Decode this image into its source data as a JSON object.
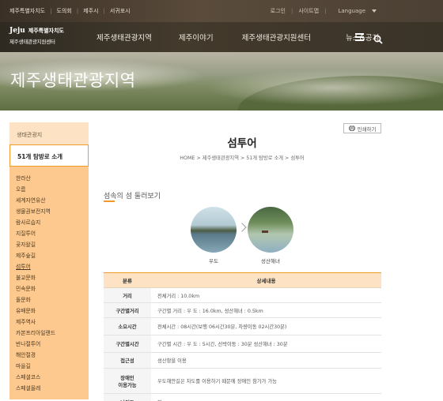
{
  "topbar": {
    "links": [
      "제주특별자치도",
      "도의회",
      "제주시",
      "서귀포시"
    ],
    "login": "로그인",
    "sitemap": "사이트맵",
    "language": "Language"
  },
  "logo": {
    "mark": "Jeju",
    "line1": "제주특별자치도",
    "line2": "제주생태관광지원센터"
  },
  "nav": {
    "items": [
      "제주생태관광지역",
      "제주이야기",
      "제주생태관광지원센터",
      "뉴스&공지"
    ]
  },
  "hero": {
    "title": "제주생태관광지역"
  },
  "sidebar": {
    "header": "생태관광지",
    "selected": "51개 탐방로 소개",
    "items": [
      "한라산",
      "오름",
      "세계자연유산",
      "생물권보전지역",
      "람사르습지",
      "지질투어",
      "곶자왈길",
      "제주숲길",
      "섬투어",
      "불교문화",
      "민속문화",
      "돌문화",
      "유배문화",
      "제주역사",
      "카본프리아일랜드",
      "반나절투어",
      "해안절경",
      "마을길",
      "스페셜코스",
      "스페셜올레"
    ],
    "active_index": 8
  },
  "content": {
    "print_label": "인쇄하기",
    "title": "섬투어",
    "breadcrumb": "HOME > 제주생태관광지역 > 51개 탐방로 소개 > 섬투어",
    "section_title": "섬속의 섬 둘러보기",
    "islands": [
      "우도",
      "성산해녀"
    ],
    "table_headers": [
      "분류",
      "상세내용"
    ],
    "rows": [
      {
        "key": "거리",
        "value": "전체거리 : 10.0km"
      },
      {
        "key": "구간별거리",
        "value": "구간별 거리 : 우 도 : 16.0km, 성산해녀 : 0.5km"
      },
      {
        "key": "소요시간",
        "value": "전체시간 : 08시간(보행 06시간30분, 차량이동 02시간30분)"
      },
      {
        "key": "구간별시간",
        "value": "구간별 시간 : 우 도 : 5시간, 선박이동 : 30분 성산해녀 : 30분"
      },
      {
        "key": "접근성",
        "value": "성산항을 이용"
      },
      {
        "key": "장애인\n이용가능",
        "value": "우도해안길은 차도를 이용하기 때문에 장애인 참가가 가능"
      },
      {
        "key": "난이도",
        "value": "하"
      }
    ]
  }
}
